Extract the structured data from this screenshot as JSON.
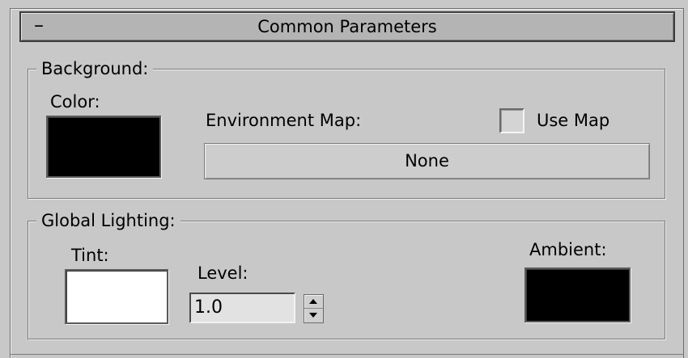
{
  "rollout": {
    "title": "Common Parameters",
    "collapse_symbol": "–"
  },
  "background": {
    "group_label": "Background:",
    "color_label": "Color:",
    "color_value": "#000000",
    "environment_map_label": "Environment Map:",
    "use_map_label": "Use Map",
    "use_map_checked": false,
    "map_button_label": "None"
  },
  "global_lighting": {
    "group_label": "Global Lighting:",
    "tint_label": "Tint:",
    "tint_value": "#ffffff",
    "level_label": "Level:",
    "level_value": "1.0",
    "ambient_label": "Ambient:",
    "ambient_value": "#000000"
  },
  "icons": {
    "collapse": "minus-icon",
    "spinner_up": "arrow-up-icon",
    "spinner_down": "arrow-down-icon"
  }
}
